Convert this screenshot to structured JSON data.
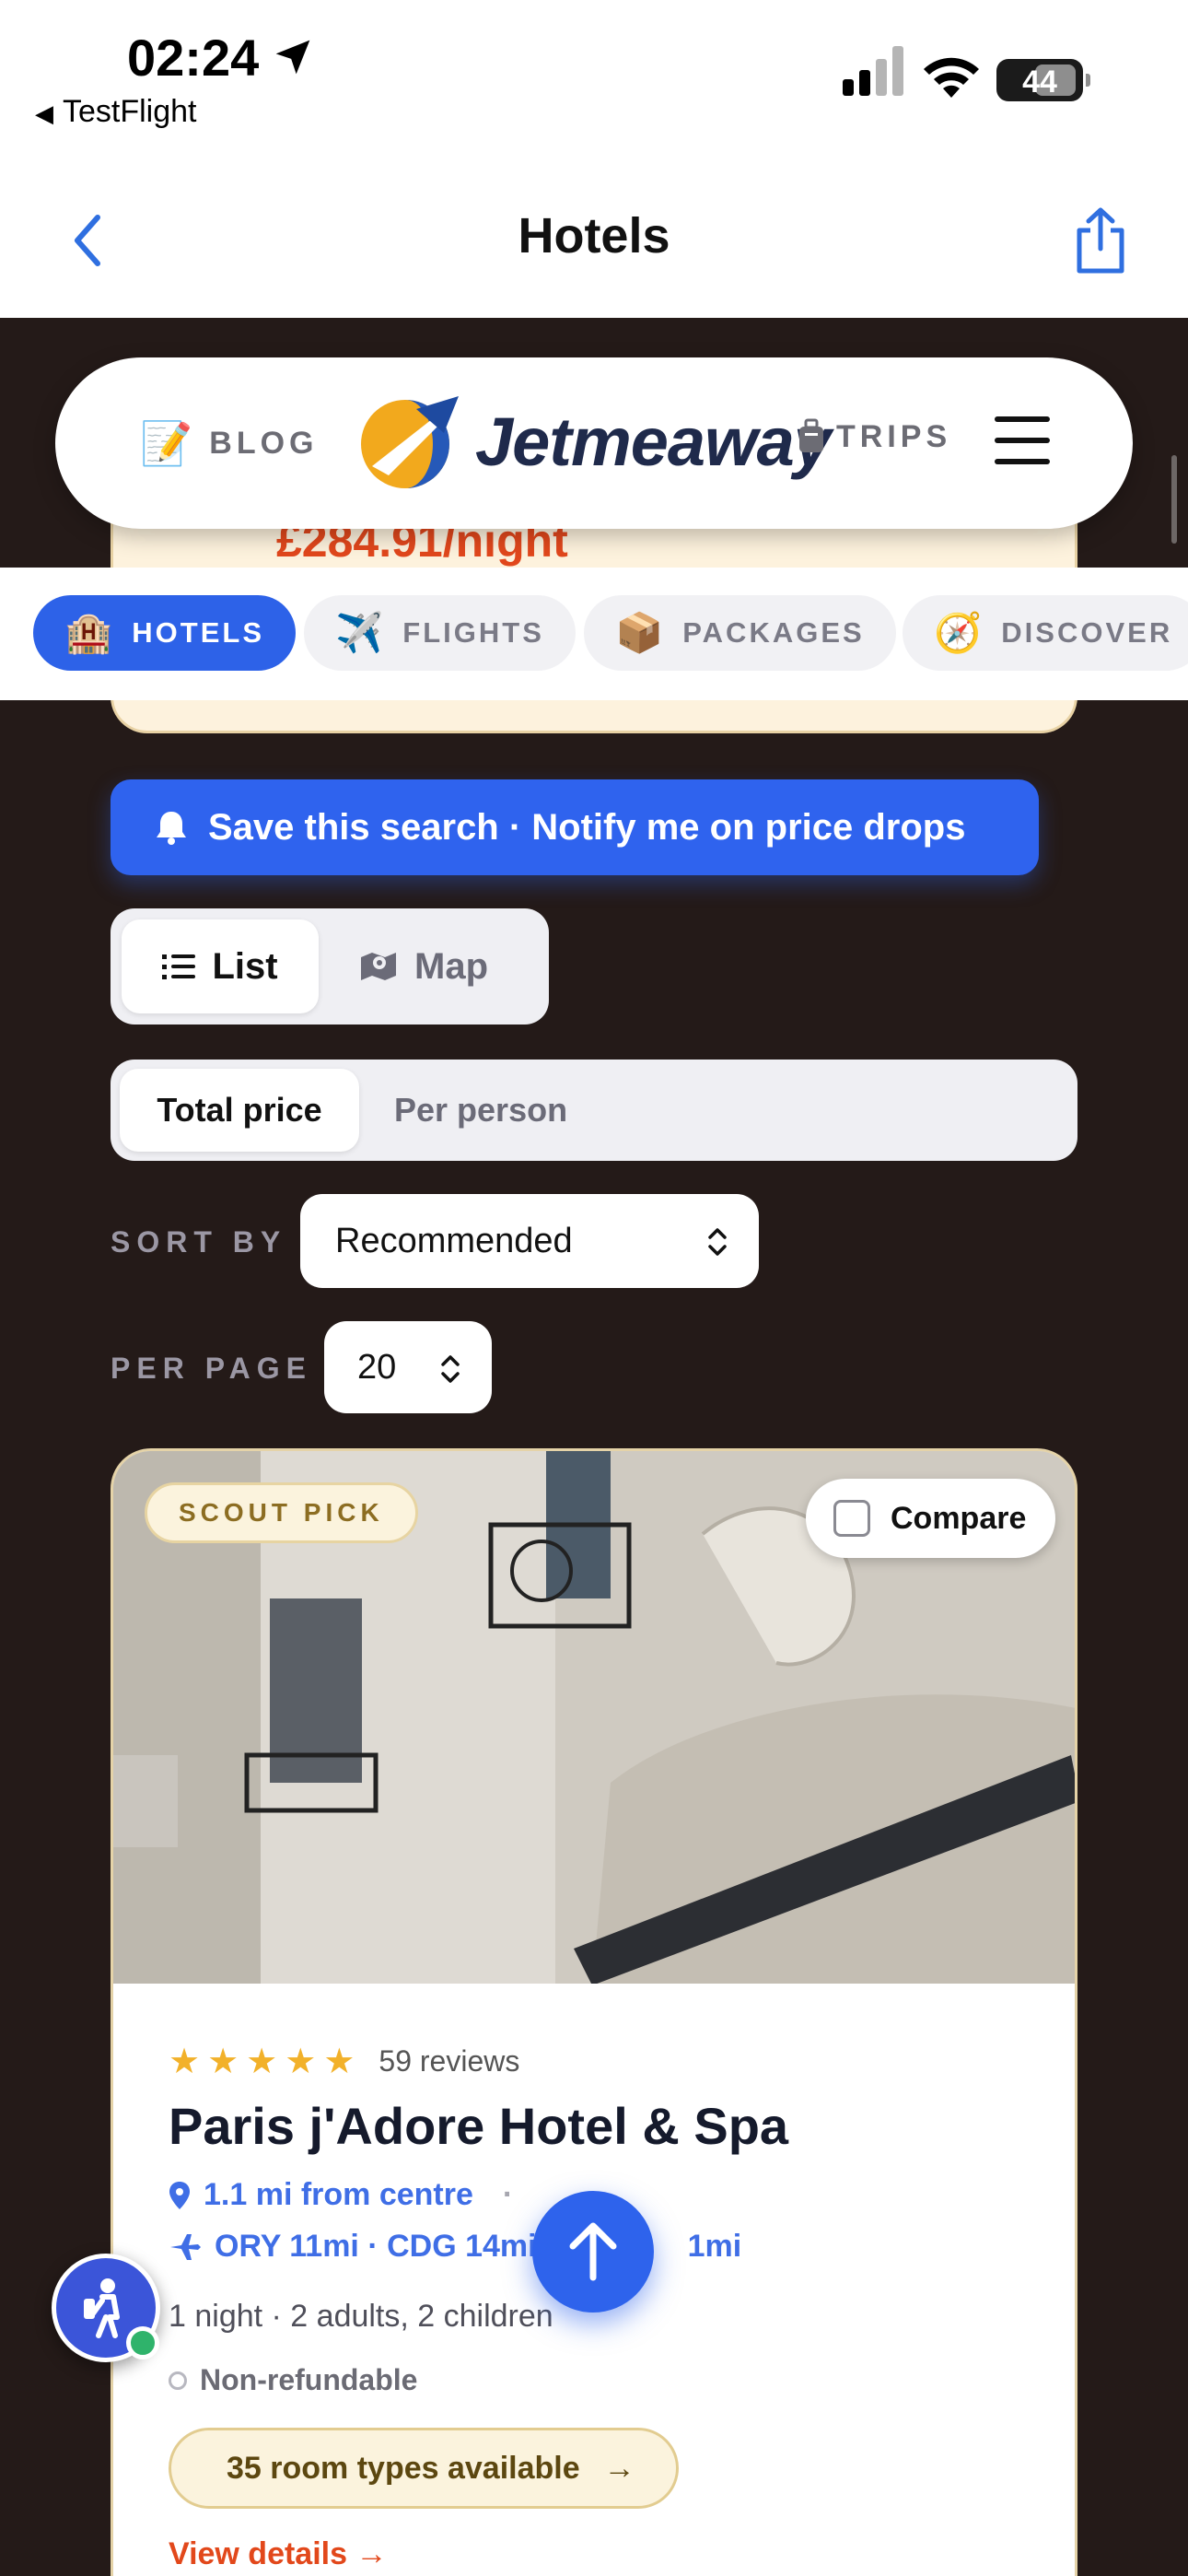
{
  "status_bar": {
    "time": "02:24",
    "back_app": "TestFlight",
    "battery": "44"
  },
  "nav": {
    "title": "Hotels"
  },
  "header": {
    "blog_label": "BLOG",
    "logo_text": "Jetmeaway",
    "trips_label": "TRIPS"
  },
  "previous_card": {
    "price": "£284.91/night"
  },
  "tabs": [
    {
      "label": "HOTELS",
      "emoji": "🏨",
      "active": true
    },
    {
      "label": "FLIGHTS",
      "emoji": "✈️",
      "active": false
    },
    {
      "label": "PACKAGES",
      "emoji": "📦",
      "active": false
    },
    {
      "label": "DISCOVER",
      "emoji": "🧭",
      "active": false
    }
  ],
  "save_search": {
    "label": "Save this search · Notify me on price drops"
  },
  "view_toggle": {
    "list_label": "List",
    "map_label": "Map",
    "selected": "List"
  },
  "price_mode": {
    "total_label": "Total price",
    "per_person_label": "Per person",
    "selected": "Total price"
  },
  "sort": {
    "label": "SORT BY",
    "value": "Recommended"
  },
  "per_page": {
    "label": "PER PAGE",
    "value": "20"
  },
  "hotel": {
    "badge": "SCOUT PICK",
    "compare_label": "Compare",
    "stars": 5,
    "reviews": "59 reviews",
    "name": "Paris j'Adore Hotel & Spa",
    "distance": "1.1 mi from centre",
    "distance_sep": "·",
    "airports": "ORY 11mi · CDG 14mi",
    "airports_tail": "1mi",
    "stay": "1 night · 2 adults, 2 children",
    "refund": "Non-refundable",
    "rooms": "35 room types available",
    "rooms_arrow": "→",
    "view_details": "View details →"
  },
  "colors": {
    "accent": "#2f63ee",
    "price": "#e1471c",
    "background": "#241a18",
    "gold": "#e5d3a8"
  }
}
